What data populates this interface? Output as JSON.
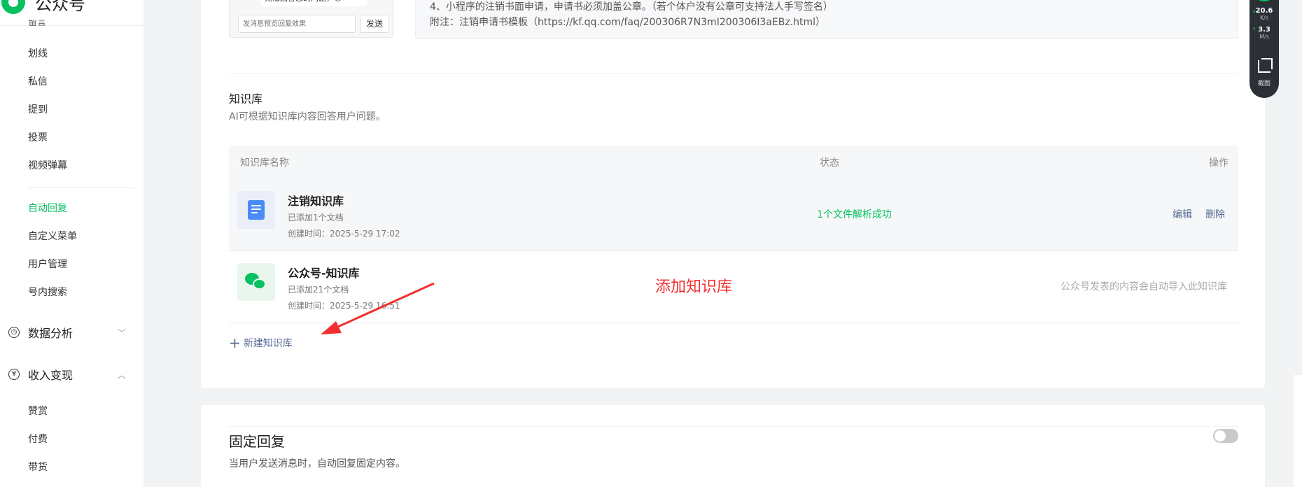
{
  "brand": {
    "name": "公众号"
  },
  "sidebar": {
    "cut_item": "留言",
    "items": [
      "划线",
      "私信",
      "提到",
      "投票",
      "视频弹幕"
    ],
    "items2": [
      "自动回复",
      "自定义菜单",
      "用户管理",
      "号内搜索"
    ],
    "group_analytics": "数据分析",
    "group_monetize": "收入变现",
    "monetize_items": [
      "赞赏",
      "付费",
      "带货"
    ]
  },
  "preview": {
    "bubble": "无法回答您的问题，😊",
    "input_placeholder": "发消息预览回复效果",
    "send_label": "发送"
  },
  "notice": {
    "line4": "4、小程序的注销书面申请，申请书必须加盖公章。（若个体户没有公章可支持法人手写签名）",
    "appendix": "附注：注销申请书模板（https://kf.qq.com/faq/200306R7N3mI200306I3aEBz.html）"
  },
  "knowledge": {
    "title": "知识库",
    "desc": "AI可根据知识库内容回答用户问题。",
    "columns": {
      "name": "知识库名称",
      "status": "状态",
      "action": "操作"
    },
    "rows": [
      {
        "name": "注销知识库",
        "docs": "已添加1个文档",
        "created": "创建时间：2025-5-29 17:02",
        "status": "1个文件解析成功",
        "edit": "编辑",
        "delete": "删除"
      },
      {
        "name": "公众号-知识库",
        "docs": "已添加21个文档",
        "created": "创建时间：2025-5-29 16:51",
        "note": "公众号发表的内容会自动导入此知识库"
      }
    ],
    "new_label": "新建知识库"
  },
  "annotation": {
    "text": "添加知识库",
    "color": "#f23030"
  },
  "fixed_reply": {
    "title": "固定回复",
    "desc": "当用户发送消息时，自动回复固定内容。",
    "enabled": false
  },
  "speed_widget": {
    "down_value": "20.6",
    "down_unit": "K/s",
    "up_value": "3.3",
    "up_unit": "M/s",
    "screenshot_label": "截图"
  },
  "colors": {
    "accent": "#07c160",
    "link": "#576b95"
  }
}
